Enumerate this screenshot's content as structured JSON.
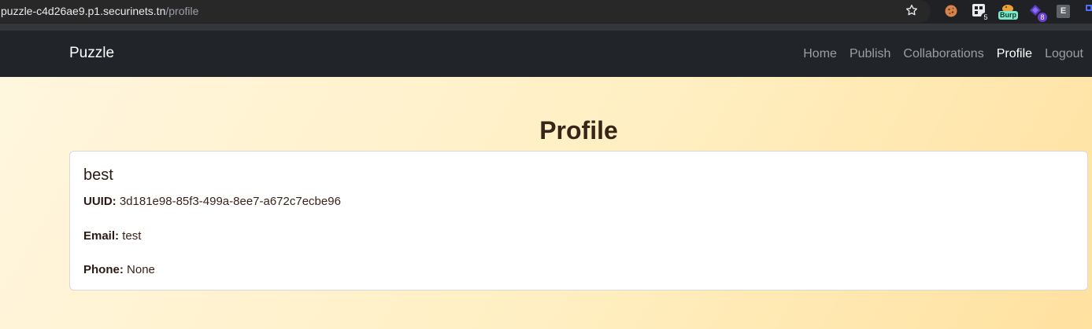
{
  "browser": {
    "url_host": "puzzle-c4d26ae9.p1.securinets.tn",
    "url_path": "/profile",
    "extensions": [
      {
        "name": "cookie-icon"
      },
      {
        "name": "badge-icon",
        "badge": "5"
      },
      {
        "name": "burp-icon",
        "label": "Burp"
      },
      {
        "name": "hacker-icon",
        "badge": "8"
      },
      {
        "name": "e-icon",
        "label": "E"
      }
    ]
  },
  "navbar": {
    "brand": "Puzzle",
    "links": [
      {
        "label": "Home"
      },
      {
        "label": "Publish"
      },
      {
        "label": "Collaborations"
      },
      {
        "label": "Profile",
        "active": true
      },
      {
        "label": "Logout"
      }
    ]
  },
  "page": {
    "title": "Profile"
  },
  "profile": {
    "name": "best",
    "uuid_label": "UUID:",
    "uuid": "3d181e98-85f3-499a-8ee7-a672c7ecbe96",
    "email_label": "Email:",
    "email": "test",
    "phone_label": "Phone:",
    "phone": "None"
  },
  "colors": {
    "navbar_bg": "#212529",
    "title_text": "#3a2318",
    "gradient_start": "#fff6df",
    "gradient_end": "#ffe1a0"
  }
}
